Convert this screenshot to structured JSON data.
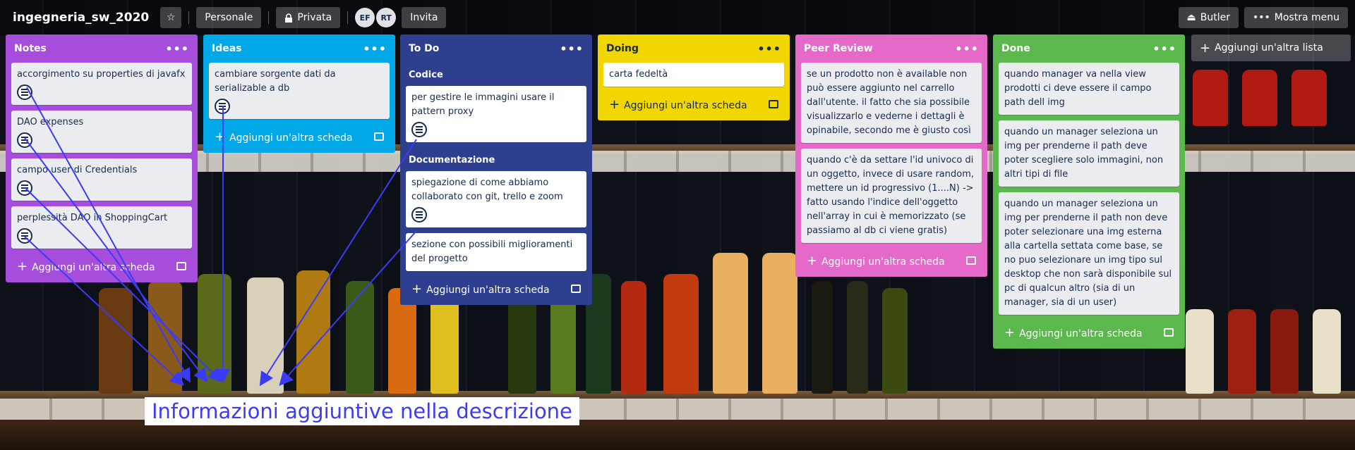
{
  "header": {
    "board_title": "ingegneria_sw_2020",
    "team_label": "Personale",
    "visibility_label": "Privata",
    "members": [
      "EF",
      "RT"
    ],
    "invite_label": "Invita",
    "butler_label": "Butler",
    "menu_label": "Mostra menu"
  },
  "add_card_label": "Aggiungi un'altra scheda",
  "add_list_label": "Aggiungi un'altra lista",
  "lists": {
    "notes": {
      "title": "Notes",
      "color": "#a64ddb",
      "cards": [
        "accorgimento su properties di javafx",
        "DAO expenses",
        "campo user di Credentials",
        "perplessità DAO in ShoppingCart"
      ]
    },
    "ideas": {
      "title": "Ideas",
      "color": "#00a8e8",
      "cards": [
        "cambiare sorgente dati da serializable a db"
      ]
    },
    "todo": {
      "title": "To Do",
      "color": "#2e3f8f",
      "section_codice": "Codice",
      "section_documentazione": "Documentazione",
      "cards": [
        "per gestire le immagini usare il pattern proxy",
        "spiegazione di come abbiamo collaborato con git, trello e zoom",
        "sezione con possibili miglioramenti del progetto"
      ]
    },
    "doing": {
      "title": "Doing",
      "color": "#f2d600",
      "cards": [
        "carta fedeltà"
      ]
    },
    "peer_review": {
      "title": "Peer Review",
      "color": "#e569c9",
      "cards": [
        "se un prodotto non è available non può essere aggiunto nel carrello dall'utente. il fatto che sia possibile visualizzarlo e vederne i dettagli è opinabile, secondo me è giusto così",
        "quando c'è da settare l'id univoco di un oggetto, invece di usare random, mettere un id progressivo (1....N) -> fatto usando l'indice dell'oggetto nell'array in cui è memorizzato (se passiamo al db ci viene gratis)"
      ]
    },
    "done": {
      "title": "Done",
      "color": "#5ab84d",
      "cards": [
        "quando manager va nella view prodotti ci deve essere il campo path dell img",
        "quando un manager seleziona un img per prenderne il path deve poter scegliere solo immagini, non altri tipi di file",
        "quando un manager seleziona un img per prenderne il path non deve poter selezionare una img esterna alla cartella settata come base, se no puo selezionare un img tipo sul desktop che non sarà disponibile sul pc di qualcun altro (sia di un manager, sia di un user)"
      ]
    }
  },
  "caption": "Informazioni aggiuntive nella descrizione",
  "arrow_color": "#3b3bf5"
}
